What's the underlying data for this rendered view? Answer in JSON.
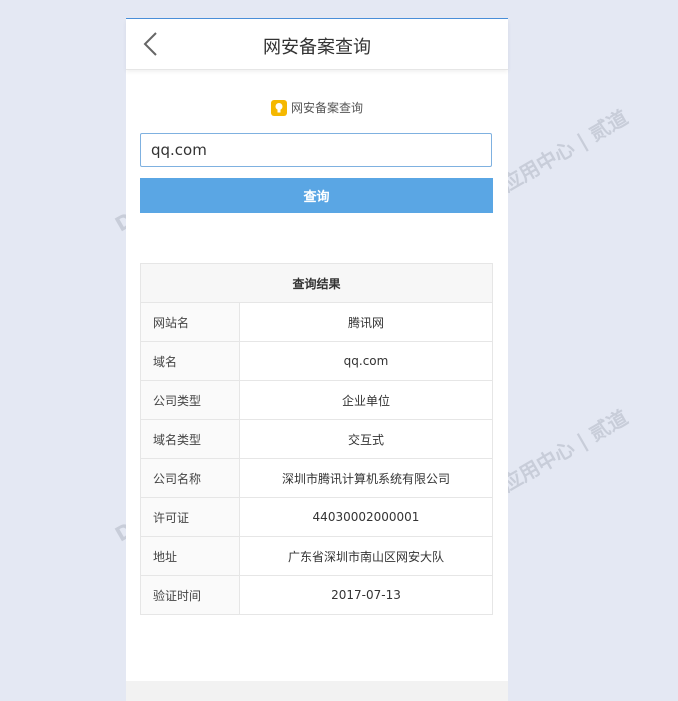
{
  "header": {
    "title": "网安备案查询"
  },
  "section": {
    "label": "网安备案查询"
  },
  "search": {
    "value": "qq.com",
    "button_label": "查询"
  },
  "results": {
    "title": "查询结果",
    "rows": [
      {
        "key": "网站名",
        "value": "腾讯网"
      },
      {
        "key": "域名",
        "value": "qq.com"
      },
      {
        "key": "公司类型",
        "value": "企业单位"
      },
      {
        "key": "域名类型",
        "value": "交互式"
      },
      {
        "key": "公司名称",
        "value": "深圳市腾讯计算机系统有限公司"
      },
      {
        "key": "许可证",
        "value": "44030002000001"
      },
      {
        "key": "地址",
        "value": "广东省深圳市南山区网安大队"
      },
      {
        "key": "验证时间",
        "value": "2017-07-13"
      }
    ]
  },
  "colors": {
    "accent": "#5aa6e4",
    "background": "#e4e8f3",
    "bulb": "#f5b800"
  },
  "icons": {
    "back": "chevron-left-icon",
    "bulb": "lightbulb-icon"
  }
}
